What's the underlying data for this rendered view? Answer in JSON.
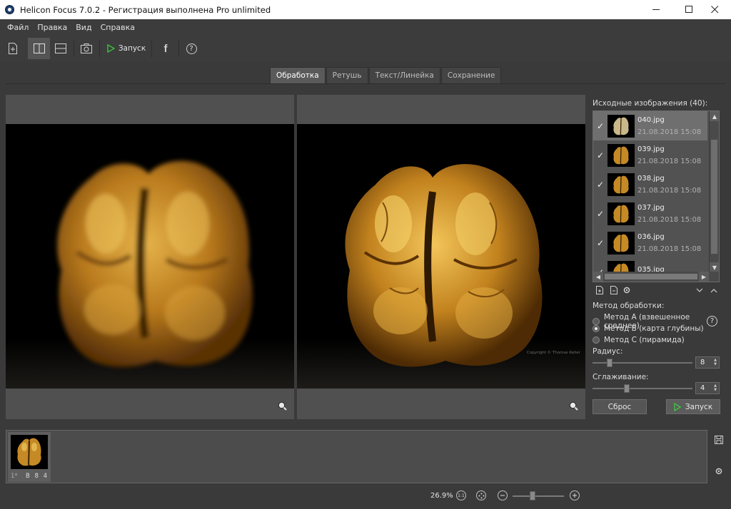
{
  "window": {
    "title": "Helicon Focus 7.0.2 - Регистрация выполнена Pro unlimited",
    "minimize_glyph": "—",
    "maximize_glyph": "☐",
    "close_glyph": "✕"
  },
  "menu": {
    "items": [
      "Файл",
      "Правка",
      "Вид",
      "Справка"
    ]
  },
  "toolbar": {
    "run_label": "Запуск",
    "facebook_glyph": "f",
    "help_glyph": "?",
    "active_layout": "side-by-side"
  },
  "tabs": [
    {
      "label": "Обработка",
      "active": true
    },
    {
      "label": "Ретушь",
      "active": false
    },
    {
      "label": "Текст/Линейка",
      "active": false
    },
    {
      "label": "Сохранение",
      "active": false
    }
  ],
  "preview": {
    "watermark": "Copyright © Thomas Keller"
  },
  "source": {
    "title": "Исходные изображения (40):",
    "files": [
      {
        "name": "040.jpg",
        "date": "21.08.2018 15:08",
        "checked": true,
        "selected": true
      },
      {
        "name": "039.jpg",
        "date": "21.08.2018 15:08",
        "checked": true,
        "selected": false
      },
      {
        "name": "038.jpg",
        "date": "21.08.2018 15:08",
        "checked": true,
        "selected": false
      },
      {
        "name": "037.jpg",
        "date": "21.08.2018 15:08",
        "checked": true,
        "selected": false
      },
      {
        "name": "036.jpg",
        "date": "21.08.2018 15:08",
        "checked": true,
        "selected": false
      },
      {
        "name": "035.jpg",
        "date": "",
        "checked": true,
        "selected": false
      }
    ]
  },
  "method": {
    "title": "Метод обработки:",
    "options": [
      {
        "label": "Метод А (взвешенное среднее)",
        "selected": false
      },
      {
        "label": "Метод B (карта глубины)",
        "selected": true
      },
      {
        "label": "Метод С (пирамида)",
        "selected": false
      }
    ],
    "help_glyph": "?"
  },
  "radius": {
    "label": "Радиус:",
    "value": "8"
  },
  "smoothing": {
    "label": "Сглаживание:",
    "value": "4"
  },
  "buttons": {
    "reset_label": "Сброс",
    "run_label": "Запуск"
  },
  "filmstrip": {
    "items": [
      {
        "index_label": "1*",
        "params_label": "B 8 4"
      }
    ]
  },
  "status": {
    "zoom": "26.9%",
    "one_to_one_glyph": "1:1"
  },
  "colors": {
    "accent_green": "#3fbf3f",
    "background": "#3a3a3a",
    "panel": "#505050"
  }
}
